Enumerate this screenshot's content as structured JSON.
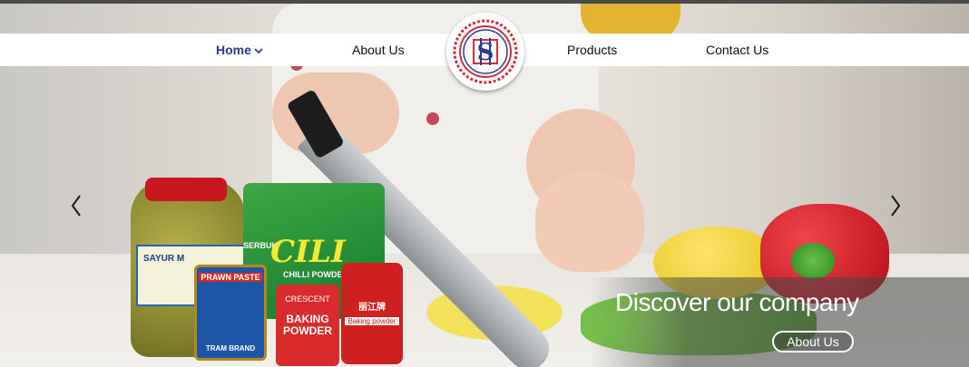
{
  "nav": {
    "items": [
      {
        "label": "Home",
        "active": true
      },
      {
        "label": "About Us",
        "active": false
      },
      {
        "label": "Products",
        "active": false
      },
      {
        "label": "Contact Us",
        "active": false
      }
    ]
  },
  "logo": {
    "text": "S"
  },
  "hero": {
    "caption": "Discover our company",
    "button_label": "About Us",
    "products": {
      "jar_label": "SAYUR M",
      "cili_pre": "SERBUK",
      "cili_title": "CILI",
      "cili_sub": "CHILLI POWDER",
      "prawn_label": "PRAWN PASTE",
      "prawn_brand": "TRAM BRAND",
      "baking1_top": "CRESCENT",
      "baking1_main": "BAKING POWDER",
      "baking2_chinese": "丽江牌",
      "baking2_label": "Baking powder"
    }
  },
  "colors": {
    "accent": "#2f3a8f",
    "logo_red": "#d32f3a",
    "logo_blue": "#2f3a8f"
  },
  "icons": {
    "prev": "chevron-left-icon",
    "next": "chevron-right-icon",
    "dropdown": "chevron-down-icon"
  }
}
